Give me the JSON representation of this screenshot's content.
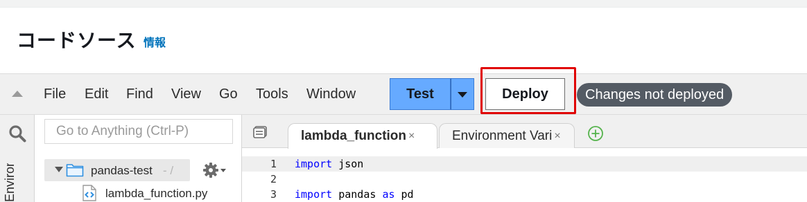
{
  "header": {
    "title": "コードソース",
    "info_link": "情報"
  },
  "menubar": {
    "items": [
      "File",
      "Edit",
      "Find",
      "View",
      "Go",
      "Tools",
      "Window"
    ],
    "test_label": "Test",
    "deploy_label": "Deploy",
    "status": "Changes not deployed"
  },
  "left_rail": {
    "label": "Environment"
  },
  "file_panel": {
    "search_placeholder": "Go to Anything (Ctrl-P)",
    "folder_name": "pandas-test",
    "folder_path": "- /",
    "file_name": "lambda_function.py"
  },
  "editor": {
    "tabs": [
      {
        "label": "lambda_function",
        "close": "×"
      },
      {
        "label": "Environment Vari",
        "close": "×"
      }
    ],
    "lines": [
      {
        "no": "1",
        "keyword": "import",
        "rest": " json"
      },
      {
        "no": "2",
        "keyword": "",
        "rest": ""
      },
      {
        "no": "3",
        "keyword": "import",
        "rest": " pandas ",
        "keyword2": "as",
        "rest2": " pd"
      }
    ]
  },
  "colors": {
    "primary_button": "#66aaff",
    "highlight_box": "#e00000",
    "status_badge": "#545b64",
    "link": "#0073bb",
    "keyword": "#0000ff"
  }
}
